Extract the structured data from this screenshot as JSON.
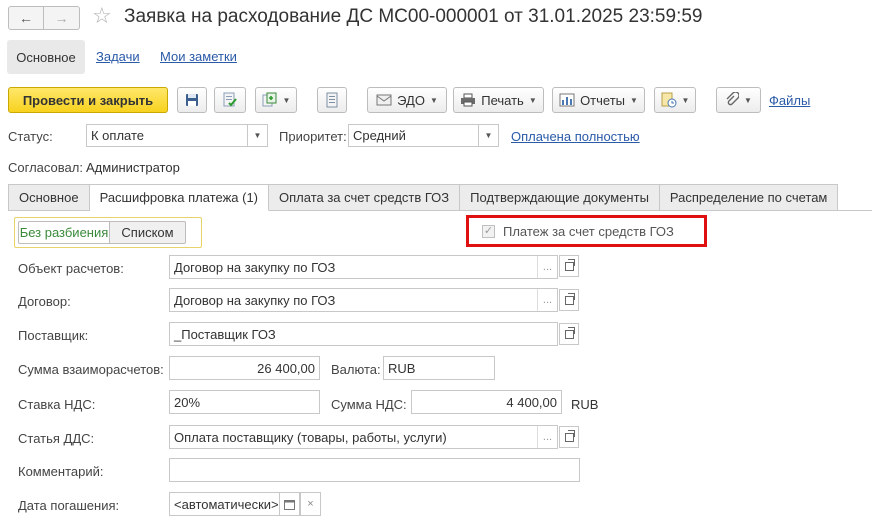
{
  "window": {
    "title": "Заявка на расходование ДС МС00-000001 от 31.01.2025 23:59:59"
  },
  "nav_links": {
    "main": "Основное",
    "tasks": "Задачи",
    "notes": "Мои заметки"
  },
  "toolbar": {
    "post_close": "Провести и закрыть",
    "edo": "ЭДО",
    "print": "Печать",
    "reports": "Отчеты",
    "files": "Файлы"
  },
  "header_form": {
    "status_label": "Статус:",
    "status_value": "К оплате",
    "priority_label": "Приоритет:",
    "priority_value": "Средний",
    "paid_link": "Оплачена полностью",
    "approved_label": "Согласовал:",
    "approved_value": "Администратор"
  },
  "tabs": [
    {
      "label": "Основное"
    },
    {
      "label": "Расшифровка платежа (1)"
    },
    {
      "label": "Оплата за счет средств ГОЗ"
    },
    {
      "label": "Подтверждающие документы"
    },
    {
      "label": "Распределение по счетам"
    }
  ],
  "split_toggle": {
    "no_split": "Без разбиения",
    "list": "Списком"
  },
  "goz_checkbox": {
    "label": "Платеж за счет средств ГОЗ",
    "checked": true
  },
  "form": {
    "settlement_object_label": "Объект расчетов:",
    "settlement_object_value": "Договор на закупку по ГОЗ",
    "contract_label": "Договор:",
    "contract_value": "Договор на закупку по ГОЗ",
    "supplier_label": "Поставщик:",
    "supplier_value": "_Поставщик ГОЗ",
    "amount_label": "Сумма взаиморасчетов:",
    "amount_value": "26 400,00",
    "currency_label": "Валюта:",
    "currency_value": "RUB",
    "vat_rate_label": "Ставка НДС:",
    "vat_rate_value": "20%",
    "vat_amount_label": "Сумма НДС:",
    "vat_amount_value": "4 400,00",
    "vat_currency": "RUB",
    "cash_flow_label": "Статья ДДС:",
    "cash_flow_value": "Оплата поставщику (товары, работы, услуги)",
    "comment_label": "Комментарий:",
    "comment_value": "",
    "due_date_label": "Дата погашения:",
    "due_date_value": "<автоматически>"
  }
}
